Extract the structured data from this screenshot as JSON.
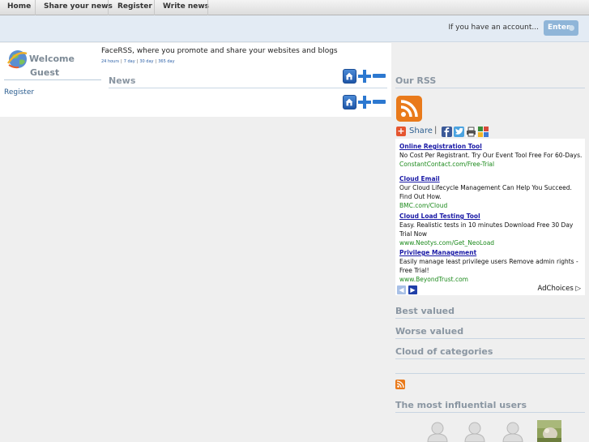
{
  "topnav": {
    "items": [
      "Home",
      "Share your news",
      "Register",
      "Write news"
    ]
  },
  "loginbar": {
    "prompt": "If you have an account...",
    "enter_label": "Enter"
  },
  "welcome": {
    "line1": "Welcome",
    "line2": "Guest",
    "register_link": "Register"
  },
  "tagline": "FaceRSS, where you promote and share your websites and blogs",
  "periods": [
    "24 hours",
    "7 day",
    "30 day",
    "365 day"
  ],
  "news": {
    "title": "News"
  },
  "sidebar": {
    "our_rss": "Our RSS",
    "share_label": "Share",
    "best_valued": "Best valued",
    "worse_valued": "Worse valued",
    "cloud_categories": "Cloud of categories",
    "influential_users": "The most influential users"
  },
  "ads": [
    {
      "title": "Online Registration Tool",
      "desc": "No Cost Per Registrant. Try Our Event Tool Free For 60-Days.",
      "url": "ConstantContact.com/Free-Trial"
    },
    {
      "title": "Cloud Email",
      "desc": "Our Cloud Lifecycle Management Can Help You Succeed. Find Out How.",
      "url": "BMC.com/Cloud"
    },
    {
      "title": "Cloud Load Testing Tool",
      "desc": "Easy. Realistic tests in 10 minutes Download Free 30 Day Trial Now",
      "url": "www.Neotys.com/Get_NeoLoad"
    },
    {
      "title": "Privilege Management",
      "desc": "Easily manage least privilege users Remove admin rights - Free Trial!",
      "url": "www.BeyondTrust.com"
    }
  ],
  "adchoices": "AdChoices",
  "colors": {
    "accent_blue": "#2c5e90",
    "section_title": "#8a96a2",
    "rss_orange": "#e06e13",
    "login_bg": "#e3ebf4",
    "ad_link": "#1a1aa6",
    "ad_url": "#1c8a1c"
  },
  "icons": {
    "home": "home-icon",
    "plus": "plus-icon",
    "minus": "minus-icon",
    "rss": "rss-icon",
    "share": "share-plus-icon",
    "facebook": "facebook-icon",
    "twitter": "twitter-icon",
    "print": "print-icon",
    "google": "google-icon"
  }
}
